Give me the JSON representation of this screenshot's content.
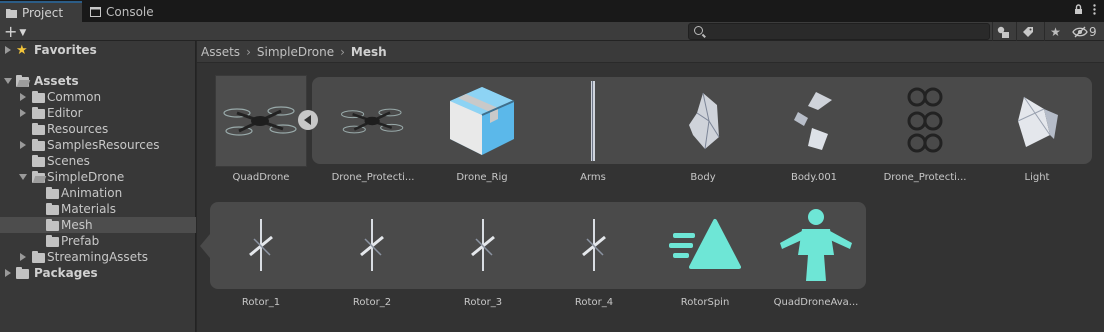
{
  "tabs": {
    "project": "Project",
    "console": "Console"
  },
  "toolbar": {
    "hidden_count": "9",
    "search_placeholder": ""
  },
  "tree": {
    "favorites": "Favorites",
    "assets": "Assets",
    "items": {
      "common": "Common",
      "editor": "Editor",
      "resources": "Resources",
      "samples": "SamplesResources",
      "scenes": "Scenes",
      "simpledrone": "SimpleDrone",
      "animation": "Animation",
      "materials": "Materials",
      "mesh": "Mesh",
      "prefab": "Prefab",
      "streaming": "StreamingAssets"
    },
    "packages": "Packages"
  },
  "breadcrumb": {
    "root": "Assets",
    "mid": "SimpleDrone",
    "current": "Mesh"
  },
  "grid": {
    "row1": [
      "QuadDrone",
      "Drone_Protecti...",
      "Drone_Rig",
      "Arms",
      "Body",
      "Body.001",
      "Drone_Protecti...",
      "Light"
    ],
    "row2": [
      "Rotor_1",
      "Rotor_2",
      "Rotor_3",
      "Rotor_4",
      "RotorSpin",
      "QuadDroneAva..."
    ]
  },
  "colors": {
    "accent": "#2c5d87",
    "star": "#f3c53a",
    "cyan": "#6ee6d6",
    "prefab_blue": "#5bb8ea"
  }
}
